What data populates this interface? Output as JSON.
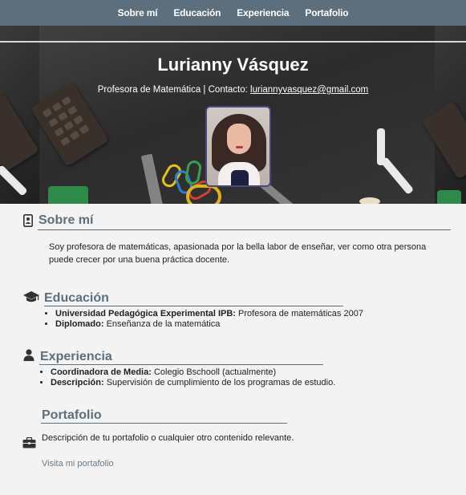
{
  "nav": {
    "items": [
      "Sobre mí",
      "Educación",
      "Experiencia",
      "Portafolio"
    ]
  },
  "hero": {
    "name": "Lurianny Vásquez",
    "subtitle_prefix": "Profesora de Matemática | Contacto: ",
    "email": "luriannyvasquez@gmail.com"
  },
  "sections": {
    "about": {
      "title": "Sobre mí",
      "icon": "id-card-icon",
      "text": "Soy profesora de matemáticas, apasionada por la bella labor de enseñar, ver como otra persona puede crecer por una buena práctica docente."
    },
    "education": {
      "title": "Educación",
      "icon": "graduation-cap-icon",
      "items": [
        {
          "label": "Universidad Pedagógica Experimental IPB:",
          "value": "Profesora de matemáticas 2007"
        },
        {
          "label": "Diplomado:",
          "value": "Enseñanza de la matemática"
        }
      ]
    },
    "experience": {
      "title": "Experiencia",
      "icon": "user-icon",
      "items": [
        {
          "label": "Coordinadora de Media:",
          "value": "Colegio Bschooll (actualmente)"
        },
        {
          "label": "Descripción:",
          "value": "Supervisión de cumplimiento de los programas de estudio."
        }
      ]
    },
    "portfolio": {
      "title": "Portafolio",
      "icon": "briefcase-icon",
      "text": "Descripción de tu portafolio o cualquier otro contenido relevante.",
      "link": "Visita mi portafolio"
    }
  },
  "colors": {
    "nav_bg": "#5d6f7c",
    "accent": "#5d6f7c",
    "page_bg": "#f3f3f3"
  }
}
